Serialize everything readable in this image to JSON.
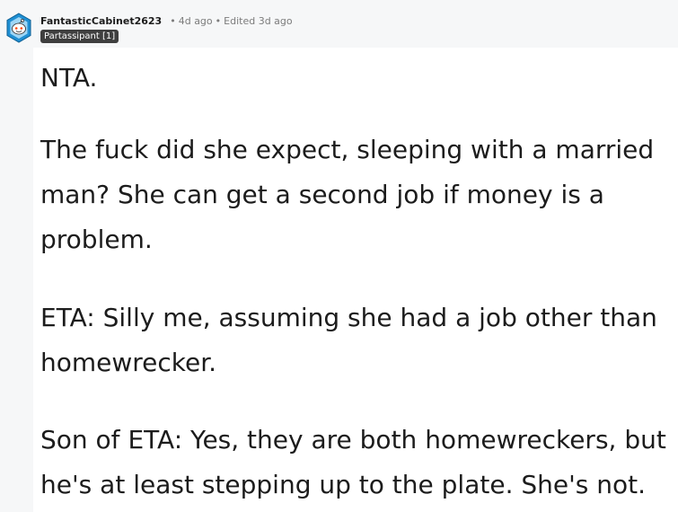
{
  "comment": {
    "username": "FantasticCabinet2623",
    "age": "4d ago",
    "edited": "Edited 3d ago",
    "flair": "Partassipant [1]",
    "avatar_icon": "snoo-avatar-icon",
    "paragraphs": [
      "NTA.",
      "The fuck did she expect, sleeping with a married man? She can get a second job if money is a problem.",
      "ETA: Silly me, assuming she had a job other than homewrecker.",
      "Son of ETA: Yes, they are both homewreckers, but he's at least stepping up to the plate. She's not."
    ]
  },
  "colors": {
    "background": "#f6f7f8",
    "card": "#ffffff",
    "text": "#1c1c1c",
    "meta": "#7c7c7c",
    "flair_bg": "#3f3f3f",
    "avatar_blue": "#1f8fd3"
  }
}
